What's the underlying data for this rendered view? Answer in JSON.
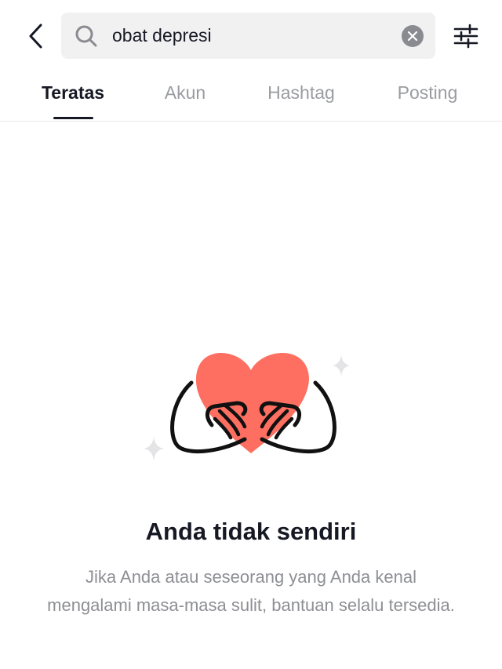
{
  "search": {
    "query": "obat depresi"
  },
  "tabs": [
    {
      "label": "Teratas",
      "active": true
    },
    {
      "label": "Akun",
      "active": false
    },
    {
      "label": "Hashtag",
      "active": false
    },
    {
      "label": "Posting",
      "active": false
    }
  ],
  "empty_state": {
    "title": "Anda tidak sendiri",
    "description": "Jika Anda atau seseorang yang Anda kenal mengalami masa-masa sulit, bantuan selalu tersedia."
  },
  "colors": {
    "heart": "#fe6f61",
    "sparkle": "#e4e4e6",
    "active_tab": "#161823",
    "inactive_tab": "#9b9ca1"
  },
  "icons": [
    "back-arrow-icon",
    "search-icon",
    "clear-icon",
    "filter-sliders-icon",
    "heart-hands-illustration",
    "sparkle-icon"
  ]
}
